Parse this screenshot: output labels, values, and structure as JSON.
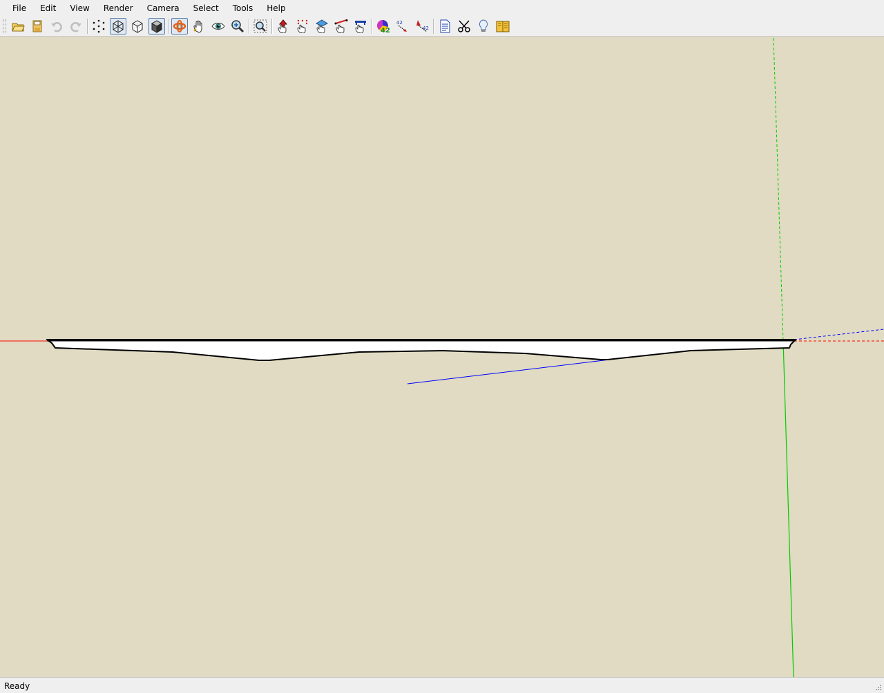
{
  "menu": [
    "File",
    "Edit",
    "View",
    "Render",
    "Camera",
    "Select",
    "Tools",
    "Help"
  ],
  "toolbar": {
    "groups": [
      [
        {
          "icon": "open-folder-icon",
          "state": "normal"
        },
        {
          "icon": "save-icon",
          "state": "normal"
        },
        {
          "icon": "undo-icon",
          "state": "disabled"
        },
        {
          "icon": "redo-icon",
          "state": "disabled"
        }
      ],
      [
        {
          "icon": "points-view-icon",
          "state": "normal"
        },
        {
          "icon": "wireframe-view-icon",
          "state": "pressed"
        },
        {
          "icon": "hidden-line-view-icon",
          "state": "normal"
        },
        {
          "icon": "shaded-view-icon",
          "state": "pressed"
        }
      ],
      [
        {
          "icon": "orbit-icon",
          "state": "pressed"
        },
        {
          "icon": "pan-hand-icon",
          "state": "normal"
        },
        {
          "icon": "look-around-eye-icon",
          "state": "normal"
        },
        {
          "icon": "zoom-magnifier-icon",
          "state": "normal"
        }
      ],
      [
        {
          "icon": "zoom-extents-icon",
          "state": "normal"
        }
      ],
      [
        {
          "icon": "select-pointer-hand-icon",
          "state": "normal"
        },
        {
          "icon": "select-vertices-hand-icon",
          "state": "normal"
        },
        {
          "icon": "select-faces-hand-icon",
          "state": "normal"
        },
        {
          "icon": "select-edges-hand-icon",
          "state": "normal"
        },
        {
          "icon": "select-texture-hand-icon",
          "state": "normal"
        }
      ],
      [
        {
          "icon": "color-wheel-icon",
          "state": "normal"
        },
        {
          "icon": "measure-distance-icon",
          "state": "normal"
        },
        {
          "icon": "measure-angle-icon",
          "state": "normal"
        }
      ],
      [
        {
          "icon": "properties-document-icon",
          "state": "normal"
        },
        {
          "icon": "section-cut-scissors-icon",
          "state": "normal"
        },
        {
          "icon": "light-bulb-icon",
          "state": "normal"
        },
        {
          "icon": "library-book-icon",
          "state": "normal"
        }
      ]
    ],
    "icon_digits": "42"
  },
  "colors": {
    "background": "#e0dbc2",
    "x_axis": "#ff0000",
    "y_axis": "#00cc00",
    "z_axis": "#0000ff",
    "model_fill": "#ffffff",
    "model_edge": "#000000"
  },
  "status": {
    "text": "Ready"
  }
}
